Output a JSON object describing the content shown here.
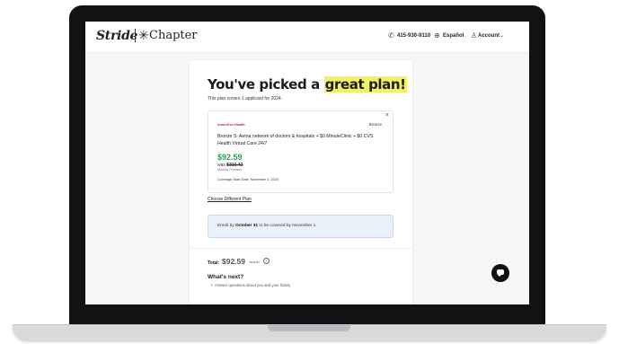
{
  "header": {
    "brand_stride": "Stride",
    "brand_chapter": "Chapter",
    "phone": "415-930-9110",
    "language": "Español",
    "account": "Account"
  },
  "page": {
    "title_prefix": "You've picked a",
    "title_highlight": "great plan!",
    "subtitle": "This plan covers 1 applicant for 2024."
  },
  "plan": {
    "carrier": "AmeriGen Health",
    "tier": "Bronze",
    "description": "Bronze S: Aetna network of doctors & hospitals + $0 MinuteClinic + $0 CVS Health Virtual Care 24/7",
    "price": "$92.59",
    "was_prefix": "was",
    "was_price": "$310.42",
    "premium_label": "Monthly Premium",
    "coverage_start": "Coverage Start Date: November 1, 2024",
    "close_label": "×"
  },
  "links": {
    "choose_different": "Choose Different Plan"
  },
  "enroll": {
    "prefix": "Enroll by",
    "date": "October 31",
    "suffix": "to be covered by November 1."
  },
  "total": {
    "label": "Total:",
    "value": "$92.59",
    "unit": "/month",
    "info": "i"
  },
  "next": {
    "title": "What's next?",
    "items": [
      "Answer questions about you and your family"
    ]
  },
  "icons": {
    "phone": "phone-icon",
    "globe": "globe-icon",
    "user": "user-icon",
    "chat": "chat-icon"
  },
  "colors": {
    "accent_highlight": "#f3f063",
    "price_green": "#2e9e59",
    "enroll_bg": "#eaf1fb"
  }
}
